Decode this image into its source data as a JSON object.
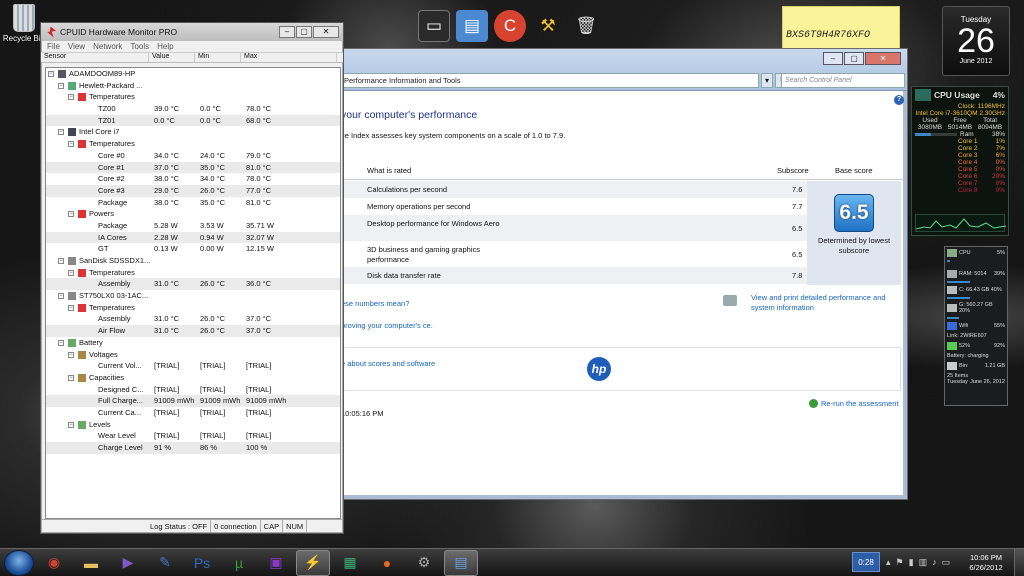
{
  "desktop": {
    "recycle_bin": "Recycle Bin",
    "sticky_note": "BXS6T9H4R76XFO"
  },
  "calendar": {
    "weekday": "Tuesday",
    "day": "26",
    "month_year": "June 2012"
  },
  "cpu_meter": {
    "title": "CPU Usage",
    "percent": "4%",
    "clock": "Clock: 1196MHz",
    "cpu_name": "Intel Core i7-3610QM 2.30GHz",
    "headers": [
      "Used",
      "Free",
      "Total"
    ],
    "values": [
      "3080MB",
      "5014MB",
      "8094MB"
    ],
    "ram_label": "Ram",
    "ram_percent": "38%",
    "ram_fraction": 0.38,
    "cores": [
      {
        "name": "Core 1",
        "value": "1%",
        "color": "#f0c030"
      },
      {
        "name": "Core 2",
        "value": "7%",
        "color": "#f0c030"
      },
      {
        "name": "Core 3",
        "value": "6%",
        "color": "#f0a030"
      },
      {
        "name": "Core 4",
        "value": "0%",
        "color": "#f07030"
      },
      {
        "name": "Core 5",
        "value": "0%",
        "color": "#e05030"
      },
      {
        "name": "Core 6",
        "value": "20%",
        "color": "#e04040"
      },
      {
        "name": "Core 7",
        "value": "0%",
        "color": "#d03040"
      },
      {
        "name": "Core 8",
        "value": "0%",
        "color": "#c02040"
      }
    ]
  },
  "sys_monitor": {
    "cpu_label": "CPU",
    "cpu_value": "5%",
    "ram_label": "RAM: 5014",
    "ram_value": "39%",
    "disk_c": "C: 66.43 GB 40%",
    "disk_g": "G: 560.27 GB 20%",
    "wifi_label": "Wifi",
    "wifi_value": "55%",
    "link": "Link: 2WIRE607",
    "battery_a": "52%",
    "battery_b": "92%",
    "battery_status": "Battery: charging",
    "bin_label": "Bin:",
    "bin_size": "1.21 GB",
    "bin_items": "25 Items",
    "day": "Tuesday",
    "date": "June 26, 2012"
  },
  "perf": {
    "address": "Performance Information and Tools",
    "search_placeholder": "Search Control Panel",
    "heading": "your computer's performance",
    "subheading": "ce Index assesses key system components on a scale of 1.0 to 7.9.",
    "col_rated": "What is rated",
    "col_subscore": "Subscore",
    "col_base": "Base score",
    "rows": [
      {
        "label": "Calculations per second",
        "score": "7.6"
      },
      {
        "label": "Memory operations per second",
        "score": "7.7"
      },
      {
        "label": "Desktop performance for Windows Aero",
        "score": "6.5"
      },
      {
        "label": "3D business and gaming graphics performance",
        "score": "6.5"
      },
      {
        "label": "Disk data transfer rate",
        "score": "7.8"
      }
    ],
    "base_score": "6.5",
    "base_text": "Determined by lowest subscore",
    "link_numbers": "ese numbers mean?",
    "link_improve": "proving your computer's ce.",
    "link_print": "View and print detailed performance and system information",
    "link_scores": "e about scores and software",
    "hp_logo": "hp",
    "timestamp": "10:05:16 PM",
    "rerun": "Re-run the assessment"
  },
  "hwmon": {
    "title": "CPUID Hardware Monitor PRO",
    "menu": [
      "File",
      "View",
      "Network",
      "Tools",
      "Help"
    ],
    "columns": [
      "Sensor",
      "Value",
      "Min",
      "Max"
    ],
    "rows": [
      {
        "level": 0,
        "name": "ADAMDOOM89-HP",
        "value": "",
        "min": "",
        "max": "",
        "icon": "pc"
      },
      {
        "level": 1,
        "name": "Hewlett-Packard ...",
        "value": "",
        "min": "",
        "max": "",
        "icon": "board"
      },
      {
        "level": 2,
        "name": "Temperatures",
        "value": "",
        "min": "",
        "max": "",
        "icon": "temp"
      },
      {
        "level": 3,
        "name": "TZ00",
        "value": "39.0 °C",
        "min": "0.0 °C",
        "max": "78.0 °C"
      },
      {
        "level": 3,
        "name": "TZ01",
        "value": "0.0 °C",
        "min": "0.0 °C",
        "max": "68.0 °C"
      },
      {
        "level": 1,
        "name": "Intel Core i7",
        "value": "",
        "min": "",
        "max": "",
        "icon": "chip"
      },
      {
        "level": 2,
        "name": "Temperatures",
        "value": "",
        "min": "",
        "max": "",
        "icon": "temp"
      },
      {
        "level": 3,
        "name": "Core #0",
        "value": "34.0 °C",
        "min": "24.0 °C",
        "max": "79.0 °C"
      },
      {
        "level": 3,
        "name": "Core #1",
        "value": "37.0 °C",
        "min": "35.0 °C",
        "max": "81.0 °C"
      },
      {
        "level": 3,
        "name": "Core #2",
        "value": "38.0 °C",
        "min": "34.0 °C",
        "max": "78.0 °C"
      },
      {
        "level": 3,
        "name": "Core #3",
        "value": "29.0 °C",
        "min": "26.0 °C",
        "max": "77.0 °C"
      },
      {
        "level": 3,
        "name": "Package",
        "value": "38.0 °C",
        "min": "35.0 °C",
        "max": "81.0 °C"
      },
      {
        "level": 2,
        "name": "Powers",
        "value": "",
        "min": "",
        "max": "",
        "icon": "power"
      },
      {
        "level": 3,
        "name": "Package",
        "value": "5.28 W",
        "min": "3.53 W",
        "max": "35.71 W"
      },
      {
        "level": 3,
        "name": "IA Cores",
        "value": "2.28 W",
        "min": "0.94 W",
        "max": "32.07 W"
      },
      {
        "level": 3,
        "name": "GT",
        "value": "0.13 W",
        "min": "0.00 W",
        "max": "12.15 W"
      },
      {
        "level": 1,
        "name": "SanDisk SDSSDX1...",
        "value": "",
        "min": "",
        "max": "",
        "icon": "disk"
      },
      {
        "level": 2,
        "name": "Temperatures",
        "value": "",
        "min": "",
        "max": "",
        "icon": "temp"
      },
      {
        "level": 3,
        "name": "Assembly",
        "value": "31.0 °C",
        "min": "26.0 °C",
        "max": "36.0 °C"
      },
      {
        "level": 1,
        "name": "ST750LX0 03-1AC...",
        "value": "",
        "min": "",
        "max": "",
        "icon": "disk"
      },
      {
        "level": 2,
        "name": "Temperatures",
        "value": "",
        "min": "",
        "max": "",
        "icon": "temp"
      },
      {
        "level": 3,
        "name": "Assembly",
        "value": "31.0 °C",
        "min": "26.0 °C",
        "max": "37.0 °C"
      },
      {
        "level": 3,
        "name": "Air Flow",
        "value": "31.0 °C",
        "min": "26.0 °C",
        "max": "37.0 °C"
      },
      {
        "level": 1,
        "name": "Battery",
        "value": "",
        "min": "",
        "max": "",
        "icon": "battery"
      },
      {
        "level": 2,
        "name": "Voltages",
        "value": "",
        "min": "",
        "max": "",
        "icon": "volt"
      },
      {
        "level": 3,
        "name": "Current Vol...",
        "value": "[TRIAL]",
        "min": "[TRIAL]",
        "max": "[TRIAL]"
      },
      {
        "level": 2,
        "name": "Capacities",
        "value": "",
        "min": "",
        "max": "",
        "icon": "volt"
      },
      {
        "level": 3,
        "name": "Designed C...",
        "value": "[TRIAL]",
        "min": "[TRIAL]",
        "max": "[TRIAL]"
      },
      {
        "level": 3,
        "name": "Full Charge...",
        "value": "91009 mWh",
        "min": "91009 mWh",
        "max": "91009 mWh"
      },
      {
        "level": 3,
        "name": "Current Ca...",
        "value": "[TRIAL]",
        "min": "[TRIAL]",
        "max": "[TRIAL]"
      },
      {
        "level": 2,
        "name": "Levels",
        "value": "",
        "min": "",
        "max": "",
        "icon": "levels"
      },
      {
        "level": 3,
        "name": "Wear Level",
        "value": "[TRIAL]",
        "min": "[TRIAL]",
        "max": "[TRIAL]"
      },
      {
        "level": 3,
        "name": "Charge Level",
        "value": "91 %",
        "min": "86 %",
        "max": "100 %"
      }
    ],
    "status": [
      "Log Status : OFF",
      "0 connection",
      "CAP",
      "NUM"
    ]
  },
  "taskbar": {
    "timer": "0:28",
    "time": "10:06 PM",
    "date": "6/26/2012",
    "apps": [
      {
        "name": "chrome",
        "glyph": "◉",
        "color": "#d8432f"
      },
      {
        "name": "explorer",
        "glyph": "▬",
        "color": "#e8c060"
      },
      {
        "name": "media",
        "glyph": "▶",
        "color": "#7a5ac8"
      },
      {
        "name": "tool",
        "glyph": "✎",
        "color": "#3a7ac8"
      },
      {
        "name": "photoshop",
        "glyph": "Ps",
        "color": "#2a6ac8"
      },
      {
        "name": "utorrent",
        "glyph": "µ",
        "color": "#3a9a3a"
      },
      {
        "name": "cpuid",
        "glyph": "▣",
        "color": "#8a3ac8"
      },
      {
        "name": "hwmonitor",
        "glyph": "⚡",
        "color": "#d82020"
      },
      {
        "name": "app",
        "glyph": "▦",
        "color": "#3ab070"
      },
      {
        "name": "origin",
        "glyph": "●",
        "color": "#e86a20"
      },
      {
        "name": "steam",
        "glyph": "⚙",
        "color": "#aaaaaa"
      },
      {
        "name": "perf",
        "glyph": "▤",
        "color": "#6aa0d8"
      }
    ]
  }
}
